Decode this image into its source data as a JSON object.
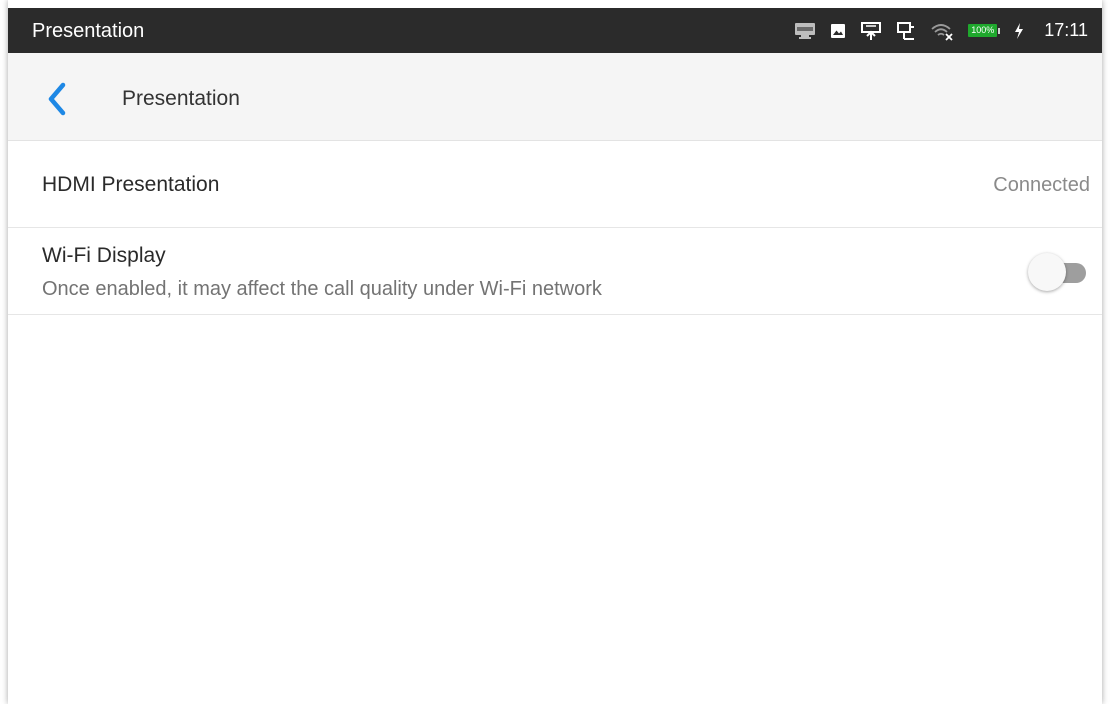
{
  "status_bar": {
    "title": "Presentation",
    "battery_label": "100%",
    "time": "17:11",
    "icons": [
      "hdmi-icon",
      "image-icon",
      "usb-network-icon",
      "ethernet-icon",
      "wifi-off-icon",
      "battery-icon",
      "charging-icon"
    ]
  },
  "app_bar": {
    "back_icon": "chevron-left-icon",
    "title": "Presentation"
  },
  "settings": {
    "hdmi": {
      "title": "HDMI Presentation",
      "value": "Connected"
    },
    "wifi_display": {
      "title": "Wi-Fi Display",
      "subtitle": "Once enabled, it may affect the call quality under Wi-Fi network",
      "enabled": false
    }
  },
  "colors": {
    "status_bar_bg": "#2b2b2b",
    "app_bar_bg": "#f5f5f5",
    "accent": "#1e88e5",
    "battery_green": "#1fa82d"
  }
}
